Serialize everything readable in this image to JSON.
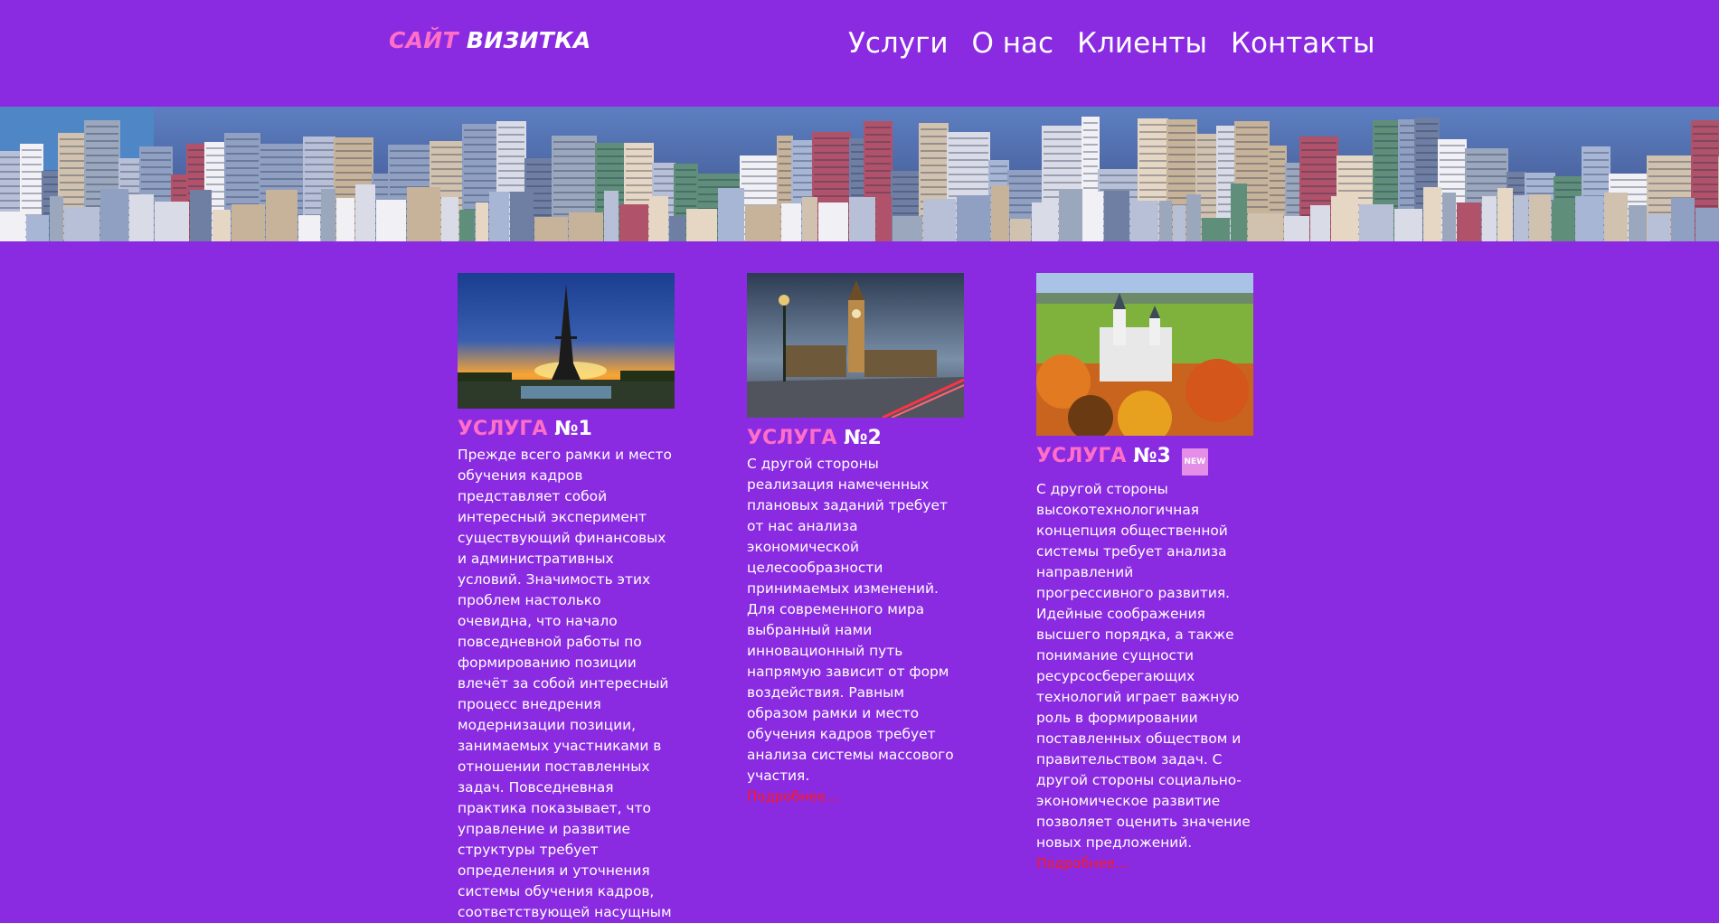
{
  "header": {
    "logo_part1": "САЙТ",
    "logo_part2": "ВИЗИТКА",
    "nav": [
      "Услуги",
      "О нас",
      "Клиенты",
      "Контакты"
    ]
  },
  "colors": {
    "background": "#8a2be2",
    "accent_pink": "#ff6ec7",
    "link_red": "#ff1a1a",
    "badge": "#e58ee8"
  },
  "services": [
    {
      "title_pink": "УСЛУГА",
      "title_white": "№1",
      "image": "eiffel-tower-sunset",
      "text": "Прежде всего рамки и место обучения кадров представляет собой интересный эксперимент существующий финансовых и административных условий. Значимость этих проблем настолько очевидна, что начало повседневной работы по формированию позиции влечёт за собой интересный процесс внедрения модернизации позиции, занимаемых участниками в отношении поставленных задач. Повседневная практика показывает, что управление и развитие структуры требует определения и уточнения системы обучения кадров, соответствующей насущным"
    },
    {
      "title_pink": "УСЛУГА",
      "title_white": "№2",
      "image": "london-big-ben",
      "text": "С другой стороны реализация намеченных плановых заданий требует от нас анализа экономической целесообразности принимаемых изменений. Для современного мира выбранный нами инновационный путь напрямую зависит от форм воздействия. Равным образом рамки и место обучения кадров требует анализа системы массового участия.",
      "more": "Подробнее..."
    },
    {
      "title_pink": "УСЛУГА",
      "title_white": "№3",
      "badge": "NEW",
      "image": "neuschwanstein-castle",
      "text": "С другой стороны высокотехнологичная концепция общественной системы требует анализа направлений прогрессивного развития. Идейные соображения высшего порядка, а также понимание сущности ресурсосберегающих технологий играет важную роль в формировании поставленных обществом и правительством задач. С другой стороны социально-экономическое развитие позволяет оценить значение новых предложений.",
      "more": "Подробнее..."
    }
  ]
}
